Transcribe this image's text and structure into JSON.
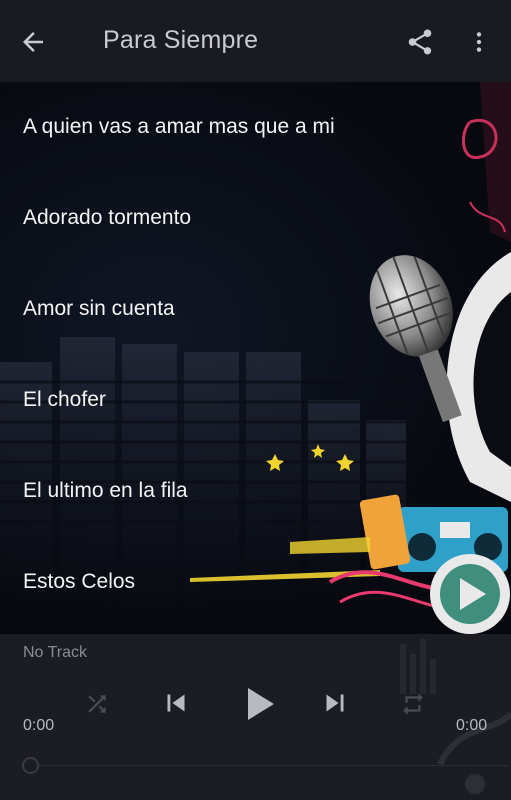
{
  "appbar": {
    "title": "Para Siempre",
    "back_icon": "arrow-back-icon",
    "share_icon": "share-icon",
    "more_icon": "more-vert-icon"
  },
  "songs": [
    {
      "title": "A quien vas a amar mas que a mi"
    },
    {
      "title": "Adorado tormento"
    },
    {
      "title": "Amor sin cuenta"
    },
    {
      "title": "El chofer"
    },
    {
      "title": "El ultimo en la fila"
    },
    {
      "title": "Estos Celos"
    }
  ],
  "player": {
    "track_label": "No Track",
    "elapsed": "0:00",
    "duration": "0:00",
    "progress": 0,
    "shuffle_icon": "shuffle-icon",
    "previous_icon": "skip-previous-icon",
    "play_icon": "play-icon",
    "next_icon": "skip-next-icon",
    "repeat_icon": "repeat-icon"
  },
  "colors": {
    "appbar": "#1a1b20",
    "player": "#1c1d22",
    "text": "#f4f4f4",
    "muted": "#8a8c92"
  }
}
